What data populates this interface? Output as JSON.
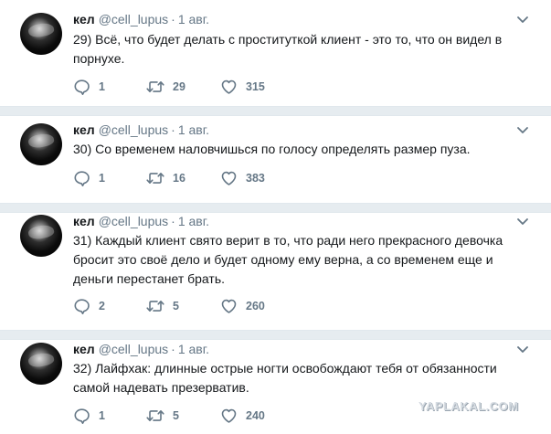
{
  "feed": {
    "tweets": [
      {
        "name": "кел",
        "handle": "@cell_lupus",
        "separator": "·",
        "date": "1 авг.",
        "text": "29) Всё, что будет делать с проституткой клиент - это то, что он видел в порнухе.",
        "replies": "1",
        "retweets": "29",
        "likes": "315"
      },
      {
        "name": "кел",
        "handle": "@cell_lupus",
        "separator": "·",
        "date": "1 авг.",
        "text": "30) Со временем наловчишься по голосу определять размер пуза.",
        "replies": "1",
        "retweets": "16",
        "likes": "383"
      },
      {
        "name": "кел",
        "handle": "@cell_lupus",
        "separator": "·",
        "date": "1 авг.",
        "text": "31) Каждый клиент свято верит в то, что ради него прекрасного девочка бросит это своё дело и будет одному ему верна, а со временем еще и деньги перестанет брать.",
        "replies": "2",
        "retweets": "5",
        "likes": "260"
      },
      {
        "name": "кел",
        "handle": "@cell_lupus",
        "separator": "·",
        "date": "1 авг.",
        "text": "32) Лайфхак: длинные острые ногти освобождают тебя от обязанности самой надевать презерватив.",
        "replies": "1",
        "retweets": "5",
        "likes": "240"
      }
    ]
  },
  "watermark": "YAPLAKAL.COM",
  "icons": {
    "reply": "reply-icon",
    "retweet": "retweet-icon",
    "like": "heart-icon",
    "menu": "chevron-down-icon",
    "avatar": "avatar"
  },
  "colors": {
    "text": "#14171a",
    "muted": "#657786",
    "separator": "#e6ecf0"
  }
}
